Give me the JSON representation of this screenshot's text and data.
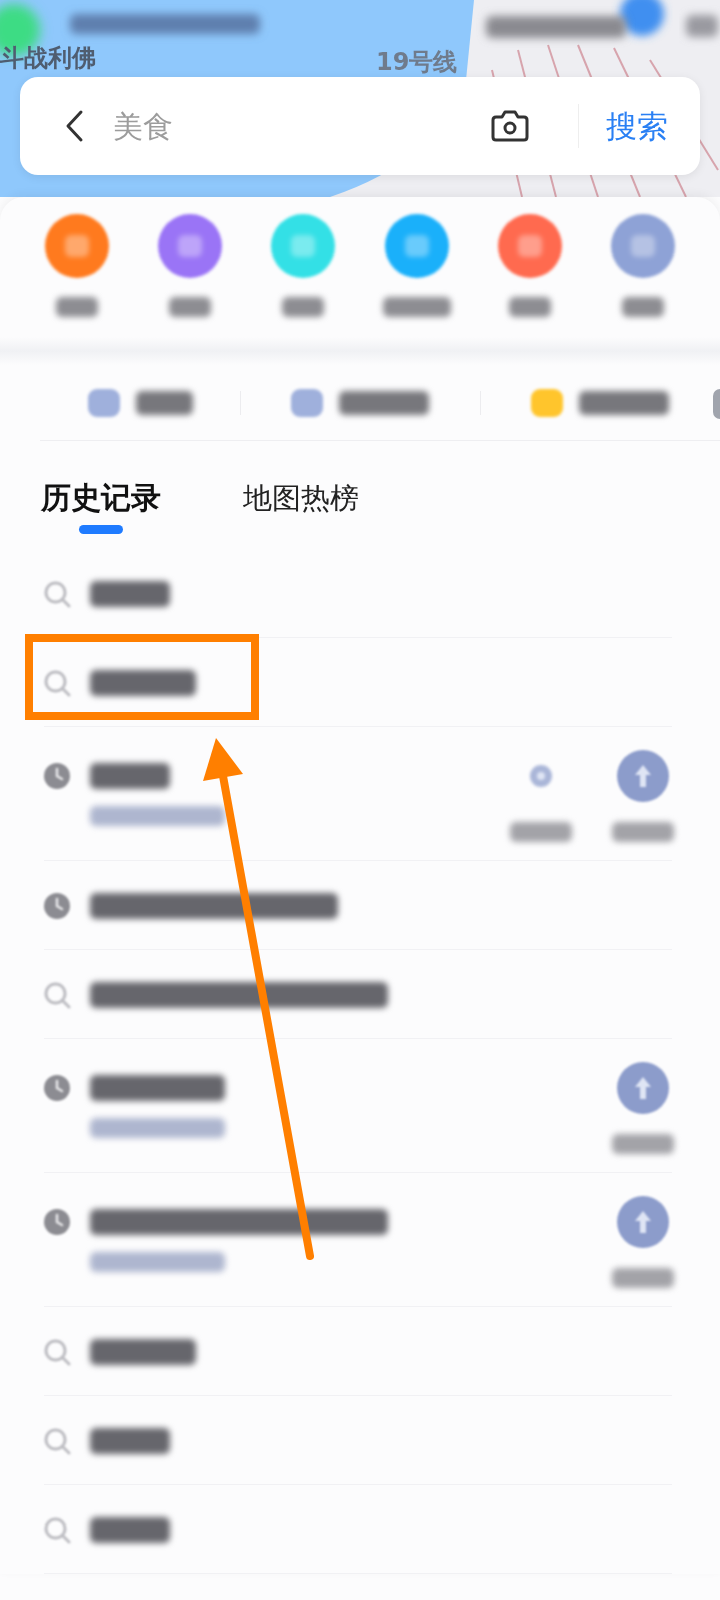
{
  "map": {
    "labels": [
      {
        "text": "斗战利佛"
      },
      {
        "text": "19号线"
      }
    ]
  },
  "search": {
    "placeholder": "美食",
    "button": "搜索"
  },
  "shortcuts": [
    {
      "color": "#ff7a1e"
    },
    {
      "color": "#9a74f6"
    },
    {
      "color": "#33e0e6"
    },
    {
      "color": "#1ab0fa"
    },
    {
      "color": "#ff6a4f"
    },
    {
      "color": "#8ea2d6"
    }
  ],
  "quick_links": [
    {
      "kind": "full",
      "color": "#9fb0dc"
    },
    {
      "kind": "full",
      "color": "#9fb0dc"
    },
    {
      "kind": "full",
      "color": "#ffc52c"
    },
    {
      "kind": "cut",
      "color": "#a0a4ad"
    }
  ],
  "tabs": [
    {
      "label": "历史记录",
      "selected": true
    },
    {
      "label": "地图热榜",
      "selected": false
    }
  ],
  "history": [
    {
      "kind": "query",
      "highlighted": false
    },
    {
      "kind": "query",
      "highlighted": true
    },
    {
      "kind": "place_detail",
      "actions": [
        {
          "kind": "plain"
        },
        {
          "kind": "filled"
        }
      ],
      "highlighted": false
    },
    {
      "kind": "place",
      "highlighted": false
    },
    {
      "kind": "query",
      "highlighted": false
    },
    {
      "kind": "place_detail",
      "actions": [
        {
          "kind": "filled"
        }
      ],
      "highlighted": false
    },
    {
      "kind": "place_detail",
      "actions": [
        {
          "kind": "filled"
        }
      ],
      "highlighted": false
    },
    {
      "kind": "query",
      "highlighted": false
    },
    {
      "kind": "query",
      "highlighted": false
    },
    {
      "kind": "query",
      "highlighted": false
    }
  ]
}
